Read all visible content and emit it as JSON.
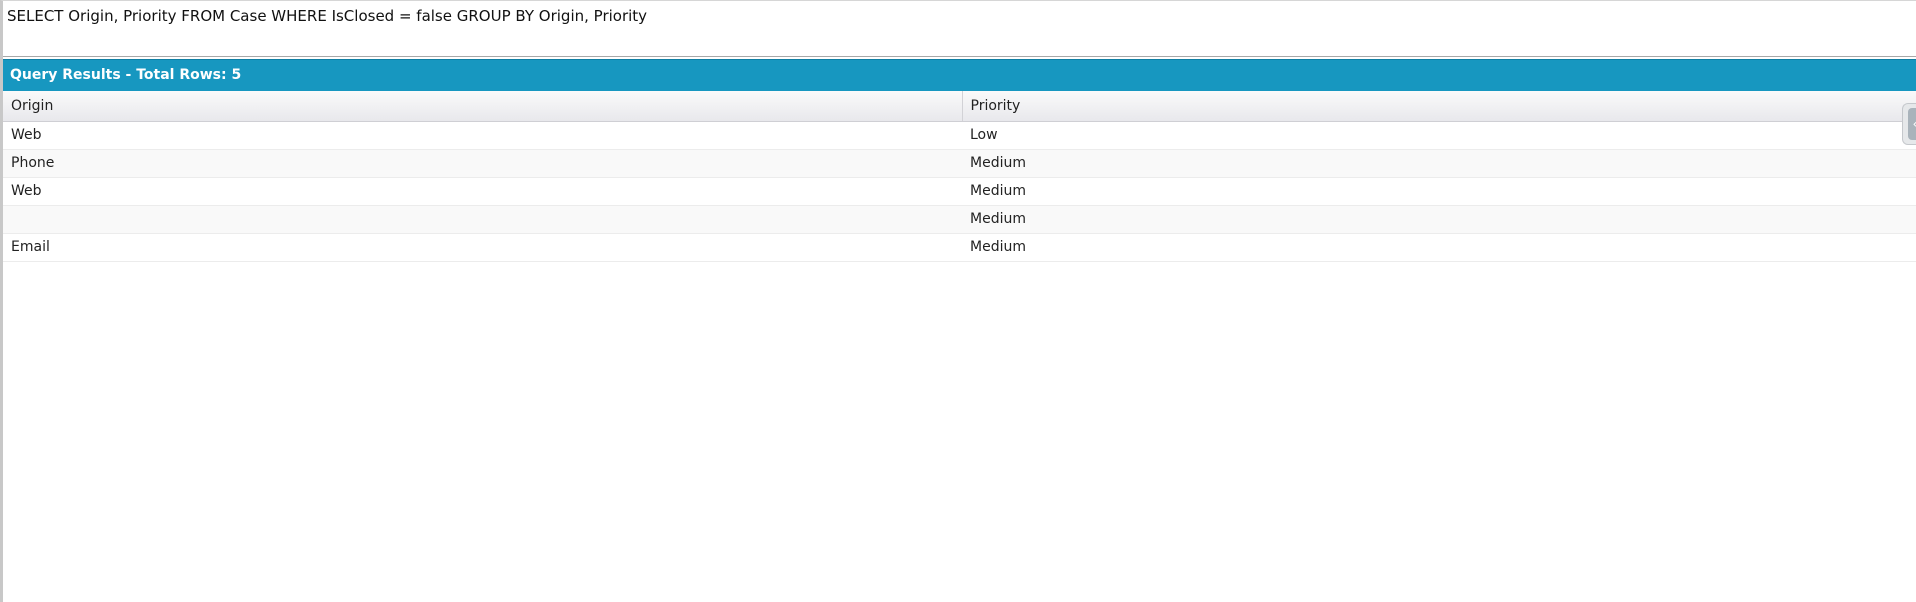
{
  "query": {
    "text": "SELECT Origin, Priority FROM Case WHERE IsClosed = false GROUP BY Origin, Priority"
  },
  "results": {
    "header": "Query Results - Total Rows: 5",
    "columns": [
      "Origin",
      "Priority"
    ],
    "rows": [
      [
        "Web",
        "Low"
      ],
      [
        "Phone",
        "Medium"
      ],
      [
        "Web",
        "Medium"
      ],
      [
        "",
        "Medium"
      ],
      [
        "Email",
        "Medium"
      ]
    ]
  },
  "icons": {
    "side_tab": "chevron-left-icon"
  },
  "colors": {
    "header_bar": "#1797c0"
  }
}
